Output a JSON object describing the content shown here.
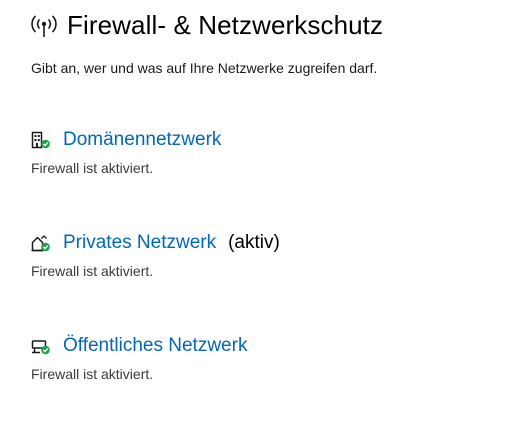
{
  "header": {
    "title": "Firewall- & Netzwerkschutz",
    "icon": "wireless-antenna-icon"
  },
  "subtitle": "Gibt an, wer und was auf Ihre Netzwerke zugreifen darf.",
  "colors": {
    "link": "#0067c0",
    "status_ok": "#16a34a"
  },
  "networks": [
    {
      "label": "Domänennetzwerk",
      "active_label": "",
      "status": "Firewall ist aktiviert.",
      "icon": "domain-building-icon"
    },
    {
      "label": "Privates Netzwerk",
      "active_label": "(aktiv)",
      "status": "Firewall ist aktiviert.",
      "icon": "private-home-icon"
    },
    {
      "label": "Öffentliches Netzwerk",
      "active_label": "",
      "status": "Firewall ist aktiviert.",
      "icon": "public-bench-icon"
    }
  ]
}
